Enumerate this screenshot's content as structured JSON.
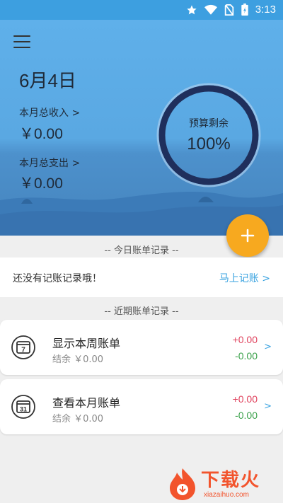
{
  "status_bar": {
    "time": "3:13",
    "icons": [
      "star-icon",
      "wifi-icon",
      "no-sim-icon",
      "battery-charging-icon"
    ]
  },
  "header": {
    "date": "6月4日",
    "income_label": "本月总收入 >",
    "income_value": "￥0.00",
    "expense_label": "本月总支出 >",
    "expense_value": "￥0.00",
    "budget_label": "预算剩余",
    "budget_value": "100%",
    "budget_fraction": 1.0
  },
  "fab": {
    "icon": "plus-icon",
    "label": "+"
  },
  "today": {
    "section_title": "-- 今日账单记录 --",
    "empty_text": "还没有记账记录哦！",
    "action_text": "马上记账 >"
  },
  "recent": {
    "section_title": "-- 近期账单记录 --",
    "cards": [
      {
        "icon_day": "7",
        "title": "显示本周账单",
        "subtitle": "结余 ￥0.00",
        "income": "+0.00",
        "expense": "-0.00",
        "chevron": ">"
      },
      {
        "icon_day": "31",
        "title": "查看本月账单",
        "subtitle": "结余 ￥0.00",
        "income": "+0.00",
        "expense": "-0.00",
        "chevron": ">"
      }
    ]
  },
  "watermark": {
    "text": "下载火",
    "url": "xiazaihuo.com"
  },
  "colors": {
    "status_bar": "#3d9fe0",
    "sky": "#5fb0ea",
    "ring": "#1f2f5c",
    "fab": "#f7a91f",
    "income": "#e0435e",
    "expense": "#3aa14a",
    "link": "#3aa3e0",
    "watermark": "#f2542d"
  }
}
